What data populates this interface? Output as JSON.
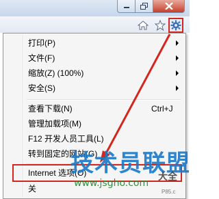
{
  "window": {
    "controls": [
      "minimize",
      "maximize",
      "close"
    ]
  },
  "toolbar": {
    "icons": [
      "home-icon",
      "star-icon",
      "gear-icon"
    ]
  },
  "menu": {
    "items": [
      {
        "label": "打印(P)",
        "shortcut": "",
        "submenu": true
      },
      {
        "label": "文件(F)",
        "shortcut": "",
        "submenu": true
      },
      {
        "label": "缩放(Z) (100%)",
        "shortcut": "",
        "submenu": true
      },
      {
        "label": "安全(S)",
        "shortcut": "",
        "submenu": true
      },
      {
        "label": "查看下载(N)",
        "shortcut": "Ctrl+J",
        "submenu": false
      },
      {
        "label": "管理加载项(M)",
        "shortcut": "",
        "submenu": false
      },
      {
        "label": "F12 开发人员工具(L)",
        "shortcut": "",
        "submenu": false
      },
      {
        "label": "转到固定的网站(G)",
        "shortcut": "",
        "submenu": false
      },
      {
        "label": "Internet 选项(O)",
        "shortcut": "",
        "submenu": false
      },
      {
        "label": "关",
        "shortcut": "",
        "submenu": false
      }
    ]
  },
  "watermark": {
    "main": "技术员联盟",
    "url": "www.jsgho.com",
    "side": "大全",
    "corner": "P85.c"
  },
  "colors": {
    "annotation": "#d3261f",
    "watermark_blue": "#1a78c6",
    "watermark_green": "#1c8a2c"
  }
}
